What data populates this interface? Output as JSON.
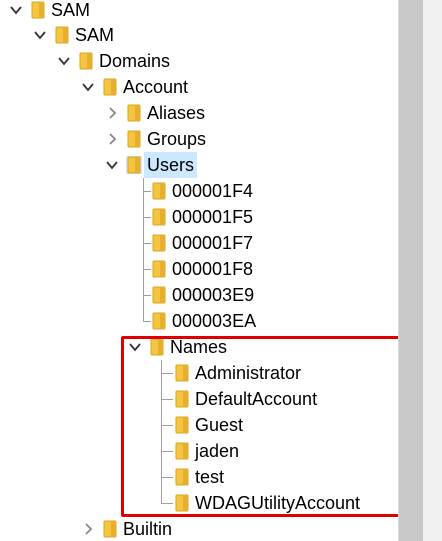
{
  "tree": {
    "sam_root": "SAM",
    "sam": "SAM",
    "domains": "Domains",
    "account": "Account",
    "aliases": "Aliases",
    "groups": "Groups",
    "users": "Users",
    "user_keys": [
      "000001F4",
      "000001F5",
      "000001F7",
      "000001F8",
      "000003E9",
      "000003EA"
    ],
    "names": "Names",
    "name_items": [
      "Administrator",
      "DefaultAccount",
      "Guest",
      "jaden",
      "test",
      "WDAGUtilityAccount"
    ],
    "builtin": "Builtin"
  },
  "colors": {
    "folder": "#f4c542",
    "selection": "#cce8ff",
    "highlight_border": "#e00000"
  },
  "icons": {
    "folder": "folder-icon",
    "expanded": "chevron-down-icon",
    "collapsed": "chevron-right-icon"
  }
}
